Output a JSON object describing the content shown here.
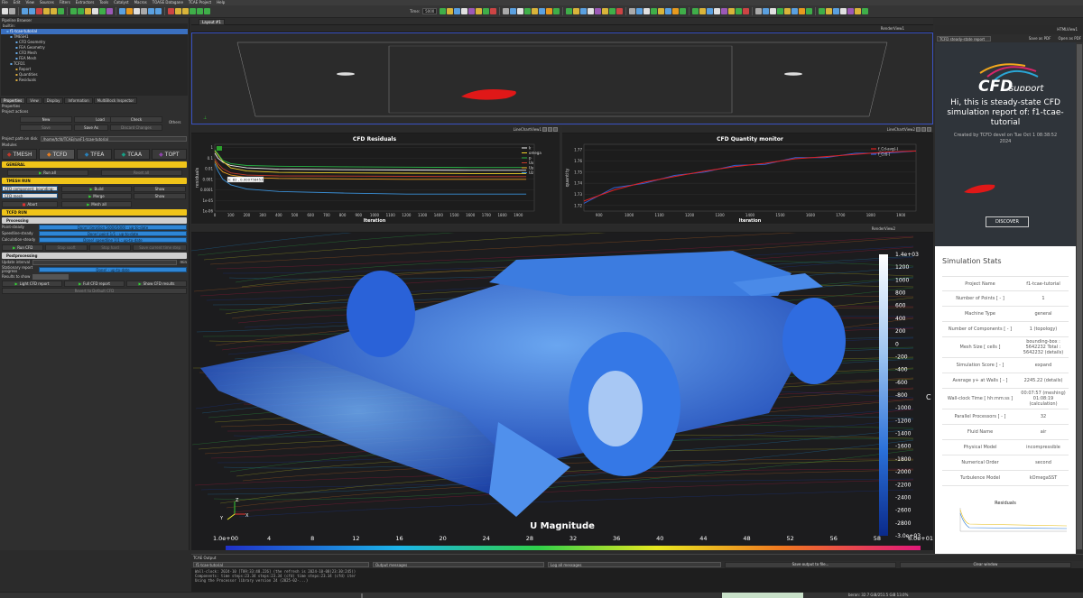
{
  "menu": [
    "File",
    "Edit",
    "View",
    "Sources",
    "Filters",
    "Extractors",
    "Tools",
    "Catalyst",
    "Macros",
    "TOASE Datagane",
    "TCAE Project",
    "Help"
  ],
  "toolbar": {
    "time_label": "Time:",
    "time_value": "5000"
  },
  "pipeline": {
    "title": "Pipeline Browser",
    "items": [
      "builtin:",
      "f1-tcae-tutorial",
      "TMESH1",
      "CFD Geometry",
      "FEA Geometry",
      "CFD Mesh",
      "FEA Mesh",
      "TCFD1",
      "Report",
      "Quantities",
      "Residuals"
    ]
  },
  "panel_tabs": [
    "Properties",
    "View",
    "Display",
    "Information",
    "MultiBlock Inspector"
  ],
  "properties": {
    "header": "Properties",
    "project_actions": "Project actions",
    "btn_new": "New",
    "btn_load": "Load",
    "btn_check": "Check",
    "btn_save": "Save",
    "btn_save_as": "Save As",
    "btn_discard": "Discard Changes",
    "others": "Others",
    "project_path_label": "Project path on disk",
    "project_path": "/home/tcfd/TCAE/runF1-tcae-tutorial",
    "modules_label": "Modules",
    "modules": [
      "TMESH",
      "TCFD",
      "TFEA",
      "TCAA",
      "TOPT"
    ],
    "general": "GENERAL",
    "btn_run_all": "Run all",
    "btn_reset_all": "Reset all",
    "tmesh_run": "TMESH RUN",
    "cfd_component": "CFD component: bounding-box",
    "cfd_mesh": "CFD mesh",
    "btn_build": "Build",
    "btn_show1": "Show",
    "btn_merge": "Merge",
    "btn_show2": "Show",
    "btn_abort": "Abort",
    "btn_mesh_all": "Mesh all",
    "tcfd_run": "TCFD RUN",
    "processing": "Processing",
    "status_rows": [
      {
        "label": "Point-steady",
        "value": "Done! iteration 5000/5000 - up-to-date"
      },
      {
        "label": "Speedline-steady",
        "value": "Done! point 1/1 - up-to-date"
      },
      {
        "label": "Calculation-steady",
        "value": "Done! speedline 1/1 - up-to-date"
      }
    ],
    "btn_run_cfd": "Run CFD",
    "btn_stop_sooft": "Stop sooft",
    "btn_stop_hard": "Stop hard",
    "btn_save_time": "Save current time step",
    "postprocessing": "Postprocessing",
    "update_interval": "Update interval",
    "update_unit": "min",
    "stationary_report": "Stationary report progress",
    "stationary_value": "Done! - up-to-date",
    "results_to_show": "Results to show",
    "btn_light_report": "Light CFD report",
    "btn_full_report": "Full CFD report",
    "btn_show_results": "Show CFD results",
    "btn_revert": "Revert to Default CFD"
  },
  "layout_tab": "Layout #1",
  "render_top": {
    "label": "RenderView1"
  },
  "residuals_chart": {
    "header": "LineChartView1",
    "chart_data": {
      "type": "line",
      "title": "CFD Residuals",
      "xlabel": "Iteration",
      "ylabel": "residuals",
      "xlim": [
        0,
        2000
      ],
      "ylog": true,
      "yticks": [
        "1",
        "0.1",
        "0.01",
        "0.001",
        "0.0001",
        "1e-05",
        "1e-06"
      ],
      "xticks": [
        "0",
        "100",
        "200",
        "300",
        "400",
        "500",
        "600",
        "700",
        "800",
        "900",
        "1000",
        "1100",
        "1200",
        "1300",
        "1400",
        "1500",
        "1600",
        "1700",
        "1800",
        "1900"
      ],
      "series": [
        {
          "name": "k",
          "color": "#f0f0f0",
          "x": [
            0,
            20,
            50,
            100,
            200,
            400,
            800,
            1200,
            1600,
            1950
          ],
          "y": [
            0.3,
            0.1,
            0.04,
            0.02,
            0.012,
            0.009,
            0.008,
            0.0075,
            0.007,
            0.007
          ]
        },
        {
          "name": "omega",
          "color": "#f0d22a",
          "x": [
            0,
            20,
            50,
            100,
            200,
            400,
            800,
            1200,
            1600,
            1950
          ],
          "y": [
            0.5,
            0.2,
            0.05,
            0.012,
            0.006,
            0.0045,
            0.004,
            0.0038,
            0.0035,
            0.0035
          ]
        },
        {
          "name": "p",
          "color": "#27b345",
          "x": [
            0,
            20,
            50,
            100,
            200,
            400,
            800,
            1200,
            1600,
            1950
          ],
          "y": [
            0.6,
            0.25,
            0.06,
            0.03,
            0.02,
            0.017,
            0.015,
            0.014,
            0.013,
            0.013
          ]
        },
        {
          "name": "Ux",
          "color": "#c23a2a",
          "x": [
            0,
            20,
            50,
            100,
            200,
            400,
            800,
            1200,
            1600,
            1950
          ],
          "y": [
            0.08,
            0.03,
            0.01,
            0.004,
            0.0025,
            0.0021,
            0.002,
            0.0019,
            0.0018,
            0.0018
          ]
        },
        {
          "name": "Uy",
          "color": "#e79a1f",
          "x": [
            0,
            20,
            50,
            100,
            200,
            400,
            800,
            1200,
            1600,
            1950
          ],
          "y": [
            0.05,
            0.015,
            0.005,
            0.0025,
            0.0015,
            0.0012,
            0.0011,
            0.001,
            0.001,
            0.001
          ]
        },
        {
          "name": "Uz",
          "color": "#3a8fd6",
          "x": [
            0,
            20,
            50,
            100,
            200,
            400,
            800,
            1200,
            1600,
            1950
          ],
          "y": [
            0.03,
            0.006,
            0.001,
            0.0003,
            0.00012,
            7e-05,
            5e-05,
            4e-05,
            4e-05,
            4e-05
          ]
        }
      ],
      "tooltip": "k: 82 , 0.000758453"
    }
  },
  "quantity_chart": {
    "header": "LineChartView2",
    "chart_data": {
      "type": "line",
      "title": "CFD Quantity monitor",
      "xlabel": "Iteration",
      "ylabel": "quantity",
      "xlim": [
        850,
        1950
      ],
      "ylim": [
        1.715,
        1.775
      ],
      "yticks": [
        "1.72",
        "1.73",
        "1.74",
        "1.75",
        "1.76",
        "1.77"
      ],
      "xticks": [
        "900",
        "1000",
        "1100",
        "1200",
        "1300",
        "1400",
        "1500",
        "1600",
        "1700",
        "1800",
        "1900"
      ],
      "series": [
        {
          "name": "f_Cd-avg(-)",
          "color": "#e02020",
          "x": [
            850,
            950,
            1050,
            1150,
            1250,
            1350,
            1450,
            1550,
            1650,
            1750,
            1850,
            1950
          ],
          "y": [
            1.724,
            1.734,
            1.741,
            1.746,
            1.751,
            1.755,
            1.758,
            1.762,
            1.764,
            1.766,
            1.768,
            1.769
          ]
        },
        {
          "name": "f_Cd(-)",
          "color": "#3060d0",
          "x": [
            850,
            950,
            1050,
            1150,
            1250,
            1350,
            1450,
            1550,
            1650,
            1750,
            1850,
            1950
          ],
          "y": [
            1.722,
            1.736,
            1.74,
            1.747,
            1.75,
            1.756,
            1.757,
            1.763,
            1.763,
            1.767,
            1.767,
            1.769
          ]
        }
      ]
    }
  },
  "render_main": {
    "label": "RenderView2",
    "colorbar_title": "U Magnitude",
    "vertical_ticks": [
      "1.4e+03",
      "1200",
      "1000",
      "800",
      "600",
      "400",
      "200",
      "0",
      "-200",
      "-400",
      "-600",
      "-800",
      "-1000",
      "-1200",
      "-1400",
      "-1600",
      "-1800",
      "-2000",
      "-2200",
      "-2400",
      "-2600",
      "-2800",
      "-3.0e+03"
    ],
    "horizontal_ticks": [
      "1.0e+00",
      "4",
      "8",
      "12",
      "16",
      "20",
      "24",
      "28",
      "32",
      "36",
      "40",
      "44",
      "48",
      "52",
      "56",
      "58",
      "6.0e+01"
    ]
  },
  "report": {
    "header_title": "TCFD steady-state report",
    "header_view": "HTMLView1",
    "btn_save_pdf": "Save as PDF",
    "btn_open_pdf": "Open as PDF",
    "logo_text": "CFD",
    "logo_sub": "support",
    "heading": "Hi, this is steady-state CFD simulation report of: f1-tcae-tutorial",
    "created_by": "Created by TCFD devel on Tue Oct 1 08:38:52 2024",
    "btn_discover": "DISCOVER",
    "stats_title": "Simulation Stats",
    "stats": [
      {
        "k": "Project Name",
        "v": "f1-tcae-tutorial"
      },
      {
        "k": "Number of Points [ - ]",
        "v": "1"
      },
      {
        "k": "Machine Type",
        "v": "general"
      },
      {
        "k": "Number of Components [ - ]",
        "v": "1 (topology)"
      },
      {
        "k": "Mesh Size [ cells ]",
        "v": "bounding-box : 5642232 Total : 5642232 (details)"
      },
      {
        "k": "Simulation Score [ - ]",
        "v": "expand"
      },
      {
        "k": "Average y+ at Walls [ - ]",
        "v": "2245.22 (details)"
      },
      {
        "k": "Wall-clock Time [ hh:mm:ss ]",
        "v": "00:07:57 (meshing) 01:08:19 (calculation)"
      },
      {
        "k": "Parallel Processors [ - ]",
        "v": "32"
      },
      {
        "k": "Fluid Name",
        "v": "air"
      },
      {
        "k": "Physical Model",
        "v": "incompressible"
      },
      {
        "k": "Numerical Order",
        "v": "second"
      },
      {
        "k": "Turbulence Model",
        "v": "kOmegaSST"
      }
    ],
    "residuals_caption": "Residuals"
  },
  "console": {
    "title": "TCAE Output",
    "project": "f1-tcae-tutorial",
    "filter": "Output messages",
    "log_filter": "Log all messages",
    "btn_save": "Save output to file...",
    "btn_clear": "Clear window",
    "lines": [
      "Wall-clock: 2024-10 [T09:33:48.226] (the refresh is 2024-10-08(23:30:245))",
      "Components: time steps:23.34 steps:23.34 (cfd) time steps:23.34 (cfd) iter",
      "Using the Processor library version 24 (2025-02-...)"
    ]
  },
  "statusbar": {
    "memory": "beran: 32.7 GiB/251.5 GiB 13.0%"
  },
  "colors": {
    "accent_blue": "#2e86d6",
    "section_yellow": "#f0c419",
    "report_dark": "#2f343a"
  }
}
